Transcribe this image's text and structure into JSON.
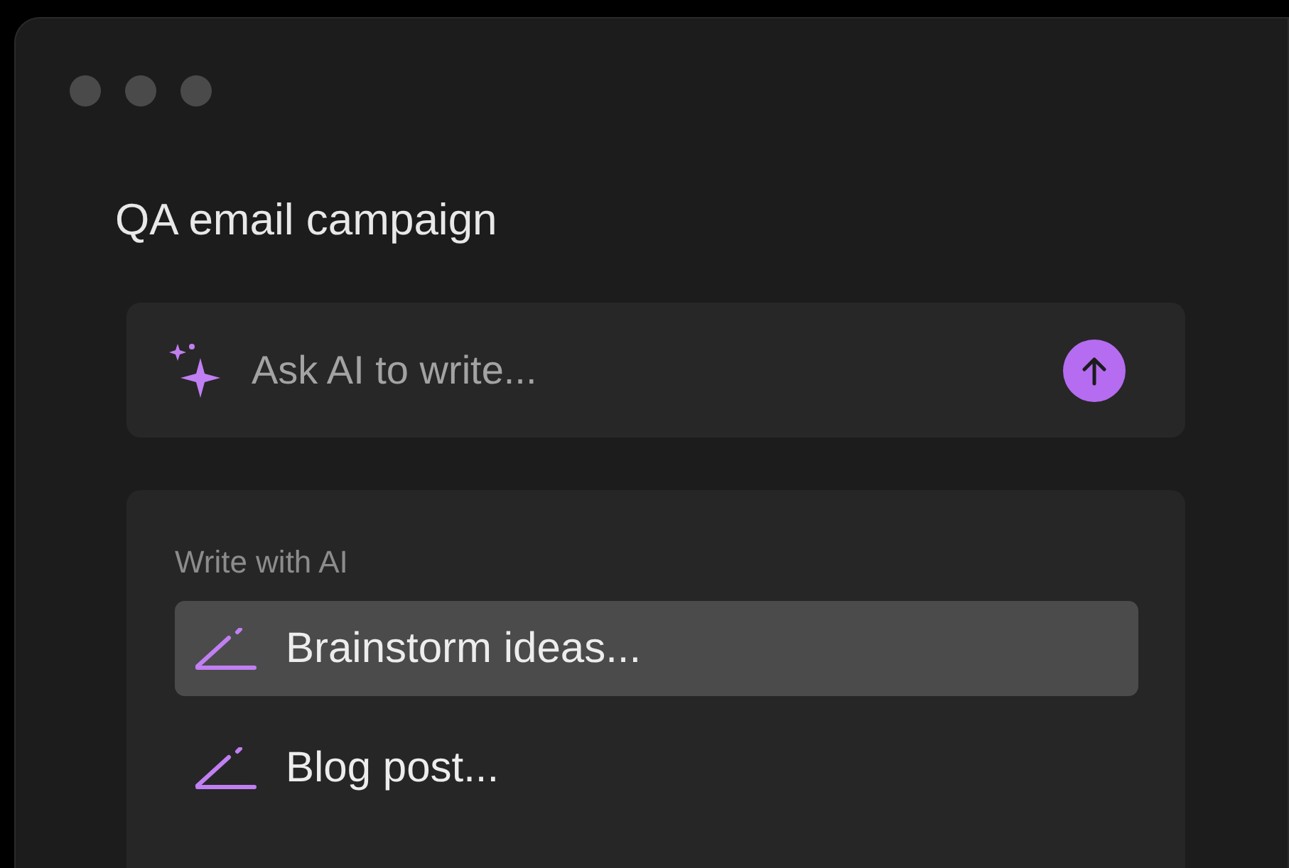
{
  "window": {
    "title": "QA email campaign"
  },
  "prompt": {
    "placeholder": "Ask AI to write..."
  },
  "menu": {
    "heading": "Write with AI",
    "items": [
      {
        "label": "Brainstorm ideas...",
        "selected": true
      },
      {
        "label": "Blog post...",
        "selected": false
      }
    ]
  }
}
